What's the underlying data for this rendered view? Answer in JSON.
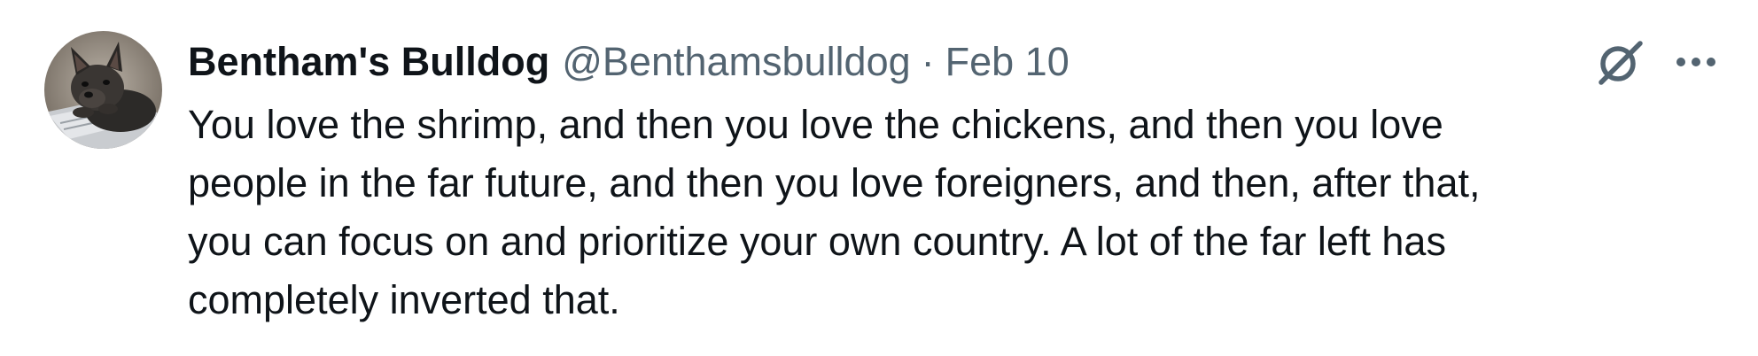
{
  "author": {
    "display_name": "Bentham's Bulldog",
    "handle": "@Benthamsbulldog",
    "avatar_icon": "french-bulldog-avatar"
  },
  "meta": {
    "separator": "·",
    "timestamp": "Feb 10"
  },
  "actions": {
    "grok_icon": "grok-icon",
    "more_icon": "more-dots-icon"
  },
  "tweet": {
    "lines": [
      "You love the shrimp, and then you love the chickens, and then you love",
      "people in the far future, and then you love foreigners, and then, after that,",
      "you can focus on and prioritize your own country. A lot of the far left has",
      "completely inverted that."
    ]
  },
  "colors": {
    "text_primary": "#0f1419",
    "text_secondary": "#536471",
    "background": "#ffffff"
  }
}
